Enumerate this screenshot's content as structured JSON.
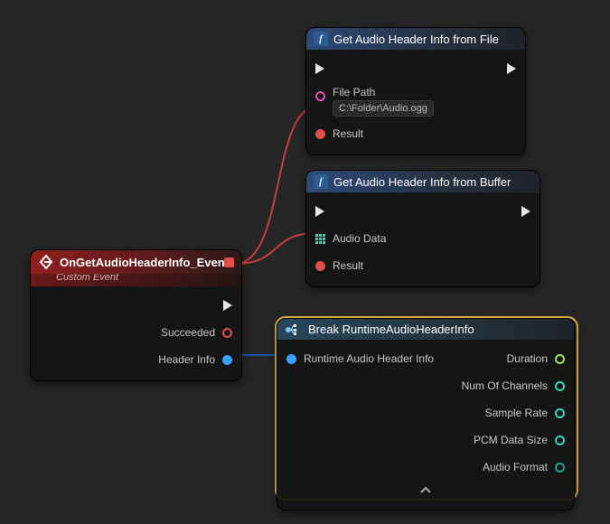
{
  "event_node": {
    "title": "OnGetAudioHeaderInfo_Event",
    "subtitle": "Custom Event",
    "outputs": {
      "succeeded": "Succeeded",
      "header_info": "Header Info"
    }
  },
  "file_node": {
    "title": "Get Audio Header Info from File",
    "inputs": {
      "file_path_label": "File Path",
      "file_path_value": "C:\\Folder\\Audio.ogg"
    },
    "outputs": {
      "result": "Result"
    }
  },
  "buffer_node": {
    "title": "Get Audio Header Info from Buffer",
    "inputs": {
      "audio_data": "Audio Data"
    },
    "outputs": {
      "result": "Result"
    }
  },
  "break_node": {
    "title": "Break RuntimeAudioHeaderInfo",
    "input_label": "Runtime Audio Header Info",
    "outputs": {
      "duration": "Duration",
      "channels": "Num Of Channels",
      "sample_rate": "Sample Rate",
      "pcm_size": "PCM Data Size",
      "audio_format": "Audio Format"
    }
  },
  "colors": {
    "wire_red": "#c73f3f",
    "wire_blue": "#1f4fae"
  }
}
